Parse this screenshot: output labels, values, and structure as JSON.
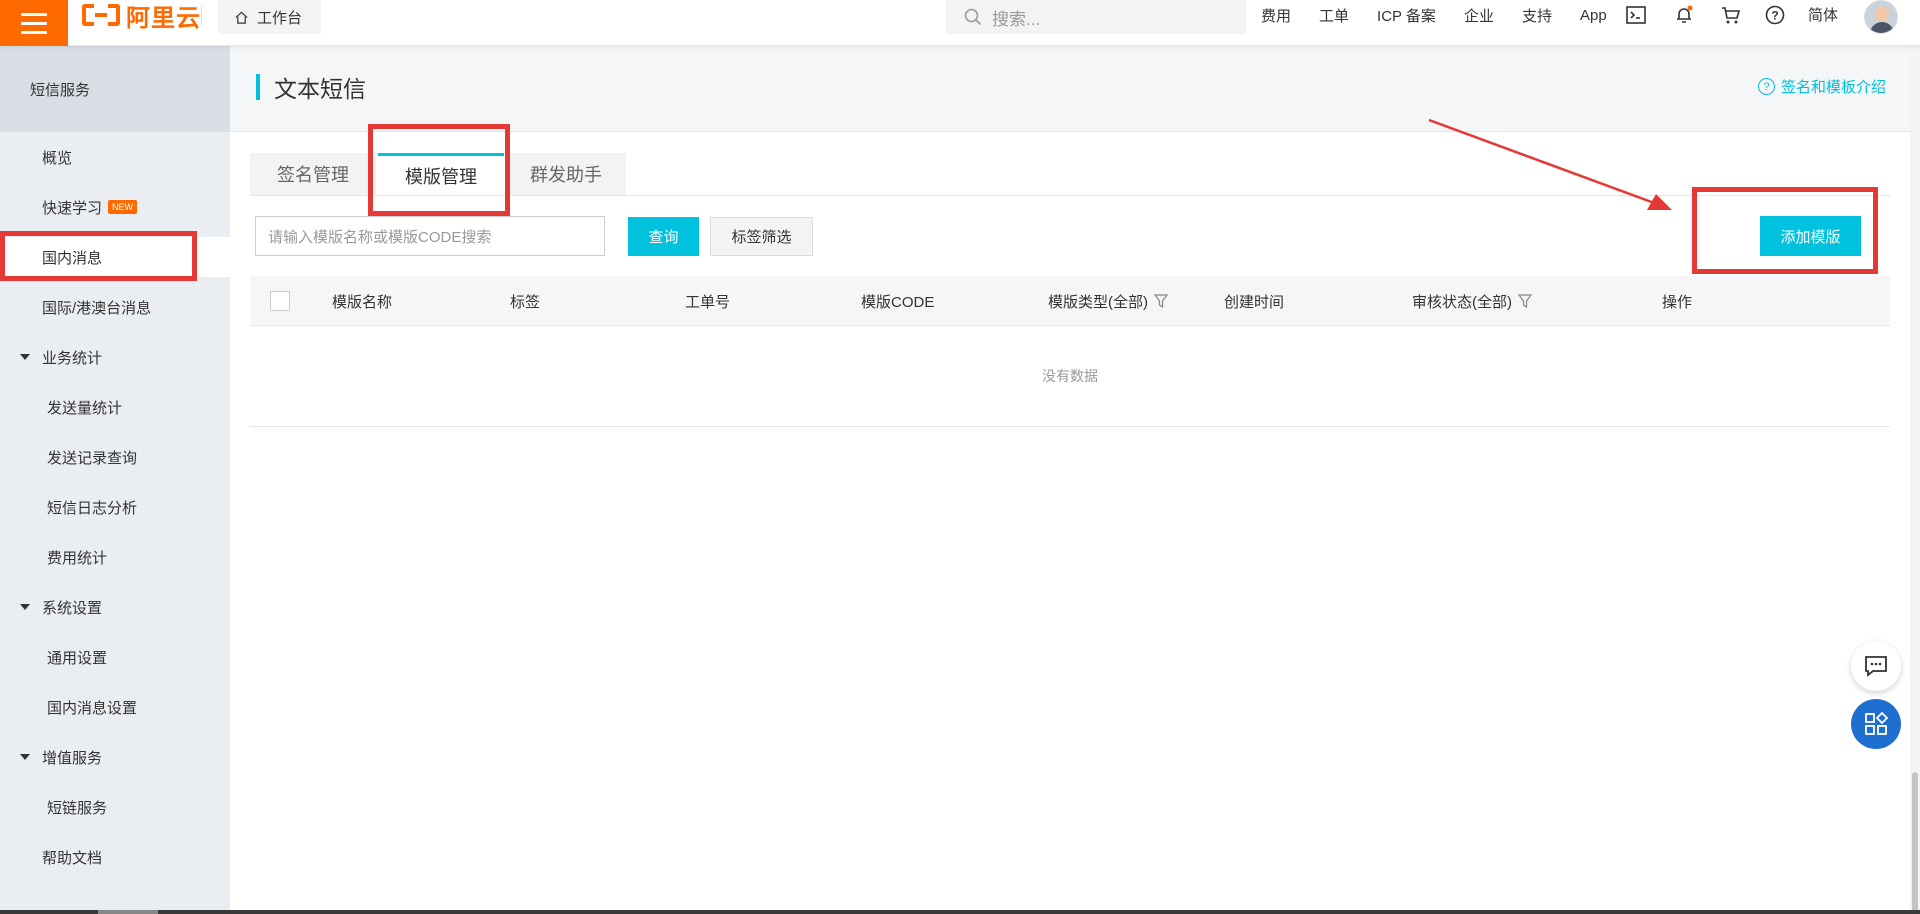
{
  "topbar": {
    "logo_text": "阿里云",
    "workbench": "工作台",
    "search_placeholder": "搜索...",
    "links": [
      "费用",
      "工单",
      "ICP 备案",
      "企业",
      "支持",
      "App"
    ],
    "language": "简体",
    "brand_color": "#ff6a00"
  },
  "sidebar": {
    "title": "短信服务",
    "items": [
      {
        "label": "概览"
      },
      {
        "label": "快速学习",
        "badge": "NEW"
      },
      {
        "label": "国内消息"
      },
      {
        "label": "国际/港澳台消息"
      },
      {
        "label": "业务统计"
      },
      {
        "label": "发送量统计"
      },
      {
        "label": "发送记录查询"
      },
      {
        "label": "短信日志分析"
      },
      {
        "label": "费用统计"
      },
      {
        "label": "系统设置"
      },
      {
        "label": "通用设置"
      },
      {
        "label": "国内消息设置"
      },
      {
        "label": "增值服务"
      },
      {
        "label": "短链服务"
      },
      {
        "label": "帮助文档"
      }
    ]
  },
  "main": {
    "title": "文本短信",
    "help_link": "签名和模板介绍",
    "help_icon": "?",
    "tabs": [
      {
        "label": "签名管理"
      },
      {
        "label": "模版管理"
      },
      {
        "label": "群发助手"
      }
    ],
    "active_tab": "模版管理",
    "filter_placeholder": "请输入模版名称或模版CODE搜索",
    "query_button": "查询",
    "tag_filter_button": "标签筛选",
    "add_button": "添加模版",
    "table": {
      "columns": [
        "模版名称",
        "标签",
        "工单号",
        "模版CODE",
        "模版类型(全部)",
        "创建时间",
        "审核状态(全部)",
        "操作"
      ],
      "empty_text": "没有数据"
    },
    "accent_color": "#00c1de"
  }
}
